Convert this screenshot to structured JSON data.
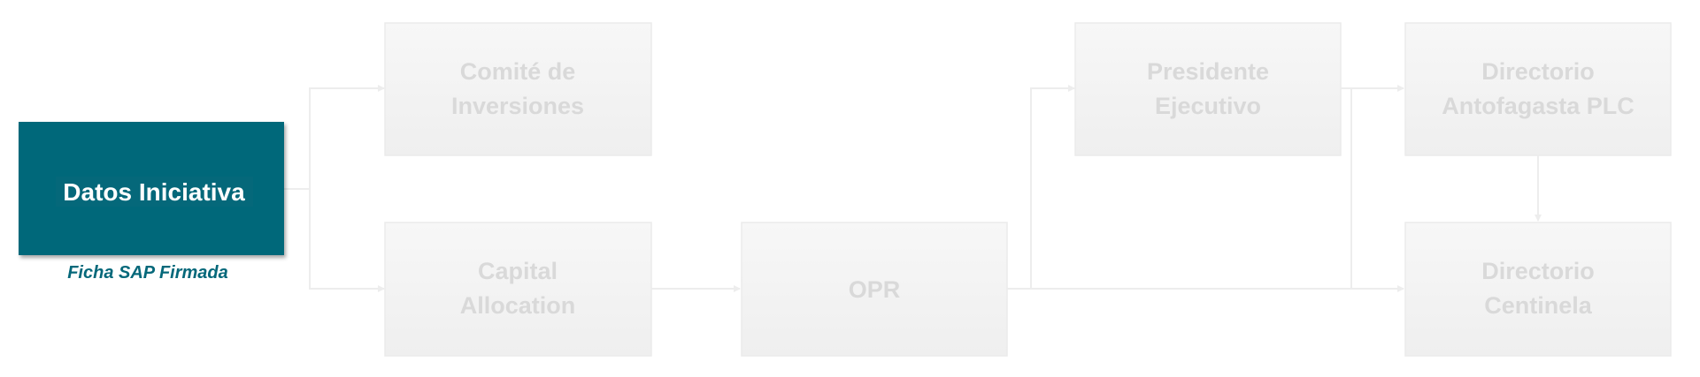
{
  "colors": {
    "active_fill": "#05687A",
    "active_text": "#ffffff",
    "inactive_text": "#D9D9D9",
    "inactive_fill_top": "#F7F7F7",
    "inactive_fill_bottom": "#EFEFEF",
    "inactive_border": "#EBEBEB",
    "connector": "#EDEDED",
    "caption": "#05687A"
  },
  "nodes": {
    "datos_iniciativa": {
      "lines": [
        "Datos Iniciativa"
      ],
      "caption": "Ficha SAP Firmada",
      "state": "active"
    },
    "comite_inversiones": {
      "lines": [
        "Comité de",
        "Inversiones"
      ],
      "state": "inactive"
    },
    "capital_allocation": {
      "lines": [
        "Capital",
        "Allocation"
      ],
      "state": "inactive"
    },
    "opr": {
      "lines": [
        "OPR"
      ],
      "state": "inactive"
    },
    "presidente_ejecutivo": {
      "lines": [
        "Presidente",
        "Ejecutivo"
      ],
      "state": "inactive"
    },
    "directorio_antofagasta": {
      "lines": [
        "Directorio",
        "Antofagasta PLC"
      ],
      "state": "inactive"
    },
    "directorio_centinela": {
      "lines": [
        "Directorio",
        "Centinela"
      ],
      "state": "inactive"
    }
  }
}
